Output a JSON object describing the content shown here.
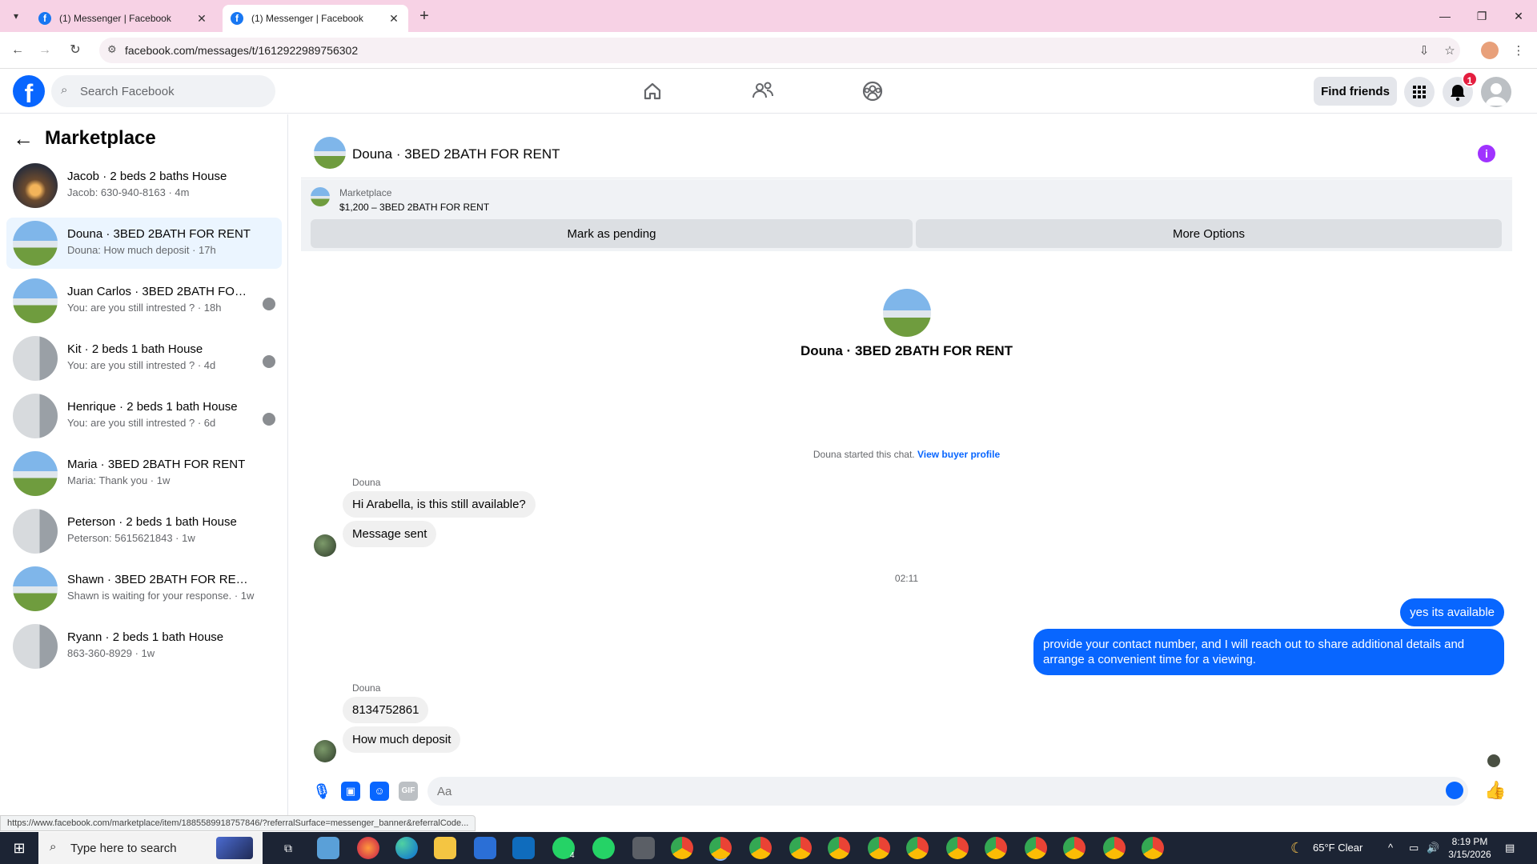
{
  "browser": {
    "tabs": [
      {
        "title": "(1) Messenger | Facebook",
        "active": false
      },
      {
        "title": "(1) Messenger | Facebook",
        "active": true
      }
    ],
    "url": "facebook.com/messages/t/1612922989756302",
    "status_url": "https://www.facebook.com/marketplace/item/1885589918757846/?referralSurface=messenger_banner&referralCode..."
  },
  "fb": {
    "search_placeholder": "Search Facebook",
    "find_friends": "Find friends",
    "notification_count": "1"
  },
  "sidebar": {
    "title": "Marketplace",
    "conversations": [
      {
        "name": "Jacob · 2 beds 2 baths House",
        "preview": "Jacob: 630-940-8163 · 4m",
        "thumb": "night",
        "selected": false,
        "seen": false
      },
      {
        "name": "Douna · 3BED 2BATH FOR RENT",
        "preview": "Douna: How much deposit · 17h",
        "thumb": "green",
        "selected": true,
        "seen": false
      },
      {
        "name": "Juan Carlos · 3BED 2BATH FOR ...",
        "preview": "You: are you still intrested ? · 18h",
        "thumb": "green",
        "selected": false,
        "seen": true
      },
      {
        "name": "Kit · 2 beds 1 bath House",
        "preview": "You: are you still intrested ? · 4d",
        "thumb": "gray",
        "selected": false,
        "seen": true
      },
      {
        "name": "Henrique · 2 beds 1 bath House",
        "preview": "You: are you still intrested ? · 6d",
        "thumb": "gray",
        "selected": false,
        "seen": true
      },
      {
        "name": "Maria · 3BED 2BATH FOR RENT",
        "preview": "Maria: Thank you · 1w",
        "thumb": "green",
        "selected": false,
        "seen": false
      },
      {
        "name": "Peterson · 2 beds 1 bath House",
        "preview": "Peterson: 5615621843 · 1w",
        "thumb": "gray",
        "selected": false,
        "seen": false
      },
      {
        "name": "Shawn · 3BED 2BATH FOR RENT",
        "preview": "Shawn is waiting for your response. · 1w",
        "thumb": "green",
        "selected": false,
        "seen": false
      },
      {
        "name": "Ryann · 2 beds 1 bath House",
        "preview": "863-360-8929 · 1w",
        "thumb": "gray",
        "selected": false,
        "seen": false
      }
    ]
  },
  "chat": {
    "title": "Douna · 3BED 2BATH FOR RENT",
    "banner_label": "Marketplace",
    "banner_price": "$1,200 – 3BED 2BATH FOR RENT",
    "mark_pending": "Mark as pending",
    "more_options": "More Options",
    "intro_name": "Douna · 3BED 2BATH FOR RENT",
    "started_text": "Douna started this chat.",
    "view_profile": "View buyer profile",
    "sender_name": "Douna",
    "msg1": "Hi Arabella, is this still available?",
    "msg2": "Message sent",
    "time_sep": "02:11",
    "out1": "yes its available",
    "out2": "provide your contact number, and I will reach out to share additional details and arrange a convenient time for a viewing.",
    "sender_name2": "Douna",
    "msg3": "8134752861",
    "msg4": "How much deposit",
    "composer_placeholder": "Aa"
  },
  "taskbar": {
    "search_text": "Type here to search",
    "weather": "65°F  Clear",
    "time": "8:19 PM",
    "date": "3/15/2026",
    "whatsapp_badge": "4"
  }
}
